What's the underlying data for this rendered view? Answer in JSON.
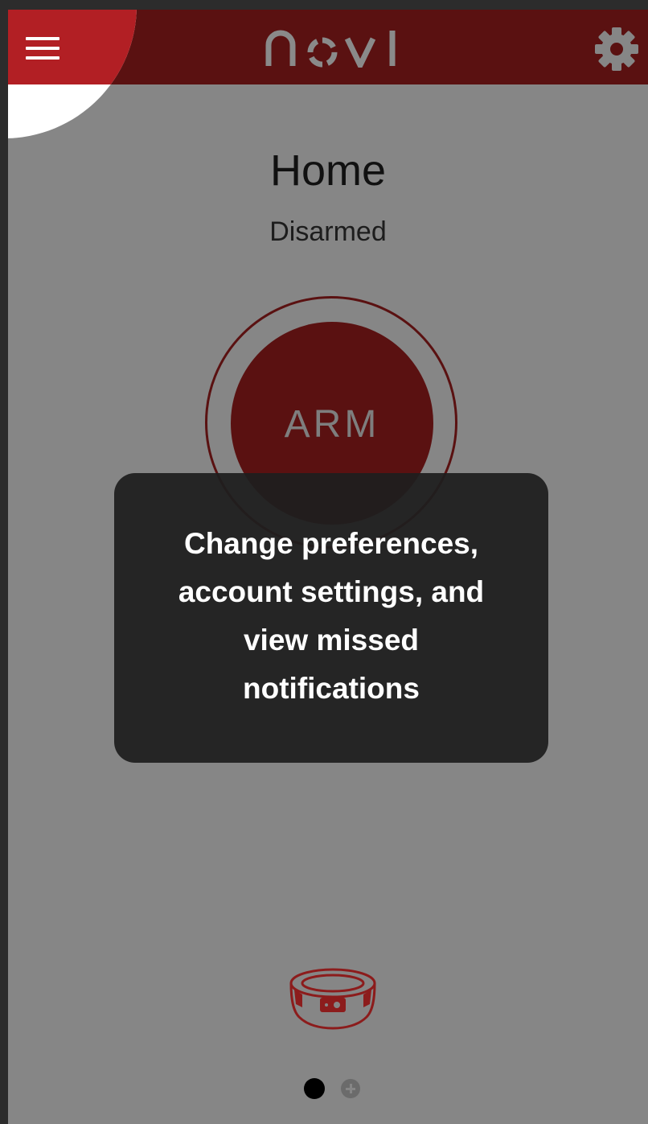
{
  "app": {
    "logo_text": "novi",
    "brand_color": "#b21f24",
    "header_color": "#5a1111"
  },
  "header": {
    "menu_icon": "hamburger-icon",
    "settings_icon": "gear-icon"
  },
  "main": {
    "title": "Home",
    "status": "Disarmed",
    "arm_label": "ARM"
  },
  "tooltip": {
    "text": "Change preferences, account settings, and view missed notifications"
  },
  "footer": {
    "device_icon": "hub-device-icon",
    "pager": {
      "pages": 1,
      "active_index": 0,
      "add_icon": "plus-icon"
    }
  }
}
